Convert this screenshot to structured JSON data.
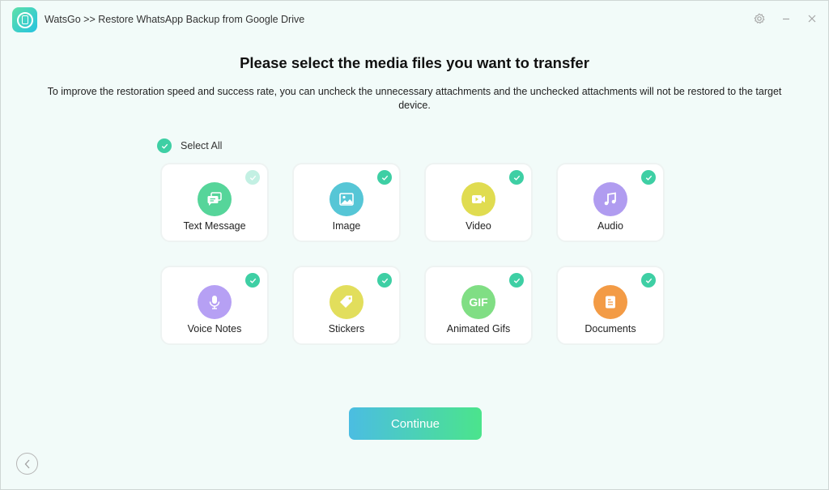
{
  "window": {
    "title": "WatsGo >> Restore WhatsApp Backup from Google Drive",
    "settings_icon": "gear-icon",
    "minimize_icon": "minimize-icon",
    "close_icon": "close-icon"
  },
  "main": {
    "heading": "Please select the media files you want to transfer",
    "description": "To improve the restoration speed and success rate, you can uncheck the unnecessary attachments and the unchecked attachments will not be restored to the target device.",
    "select_all": {
      "label": "Select All",
      "checked": true
    },
    "items": [
      {
        "label": "Text Message",
        "icon": "chat-icon",
        "color": "#56d59a",
        "checked": true,
        "disabled": true
      },
      {
        "label": "Image",
        "icon": "image-icon",
        "color": "#56c6d6",
        "checked": true
      },
      {
        "label": "Video",
        "icon": "video-icon",
        "color": "#e0dc50",
        "checked": true
      },
      {
        "label": "Audio",
        "icon": "music-icon",
        "color": "#b09cf0",
        "checked": true
      },
      {
        "label": "Voice Notes",
        "icon": "microphone-icon",
        "color": "#b6a0f4",
        "checked": true
      },
      {
        "label": "Stickers",
        "icon": "tag-icon",
        "color": "#e2de5c",
        "checked": true
      },
      {
        "label": "Animated Gifs",
        "icon": "gif-icon",
        "icon_text": "GIF",
        "color": "#80de84",
        "checked": true
      },
      {
        "label": "Documents",
        "icon": "document-icon",
        "color": "#f39b45",
        "checked": true
      }
    ],
    "continue_label": "Continue",
    "back_icon": "chevron-left-icon"
  },
  "colors": {
    "accent": "#3ecfa4",
    "background": "#f2fbf9"
  }
}
